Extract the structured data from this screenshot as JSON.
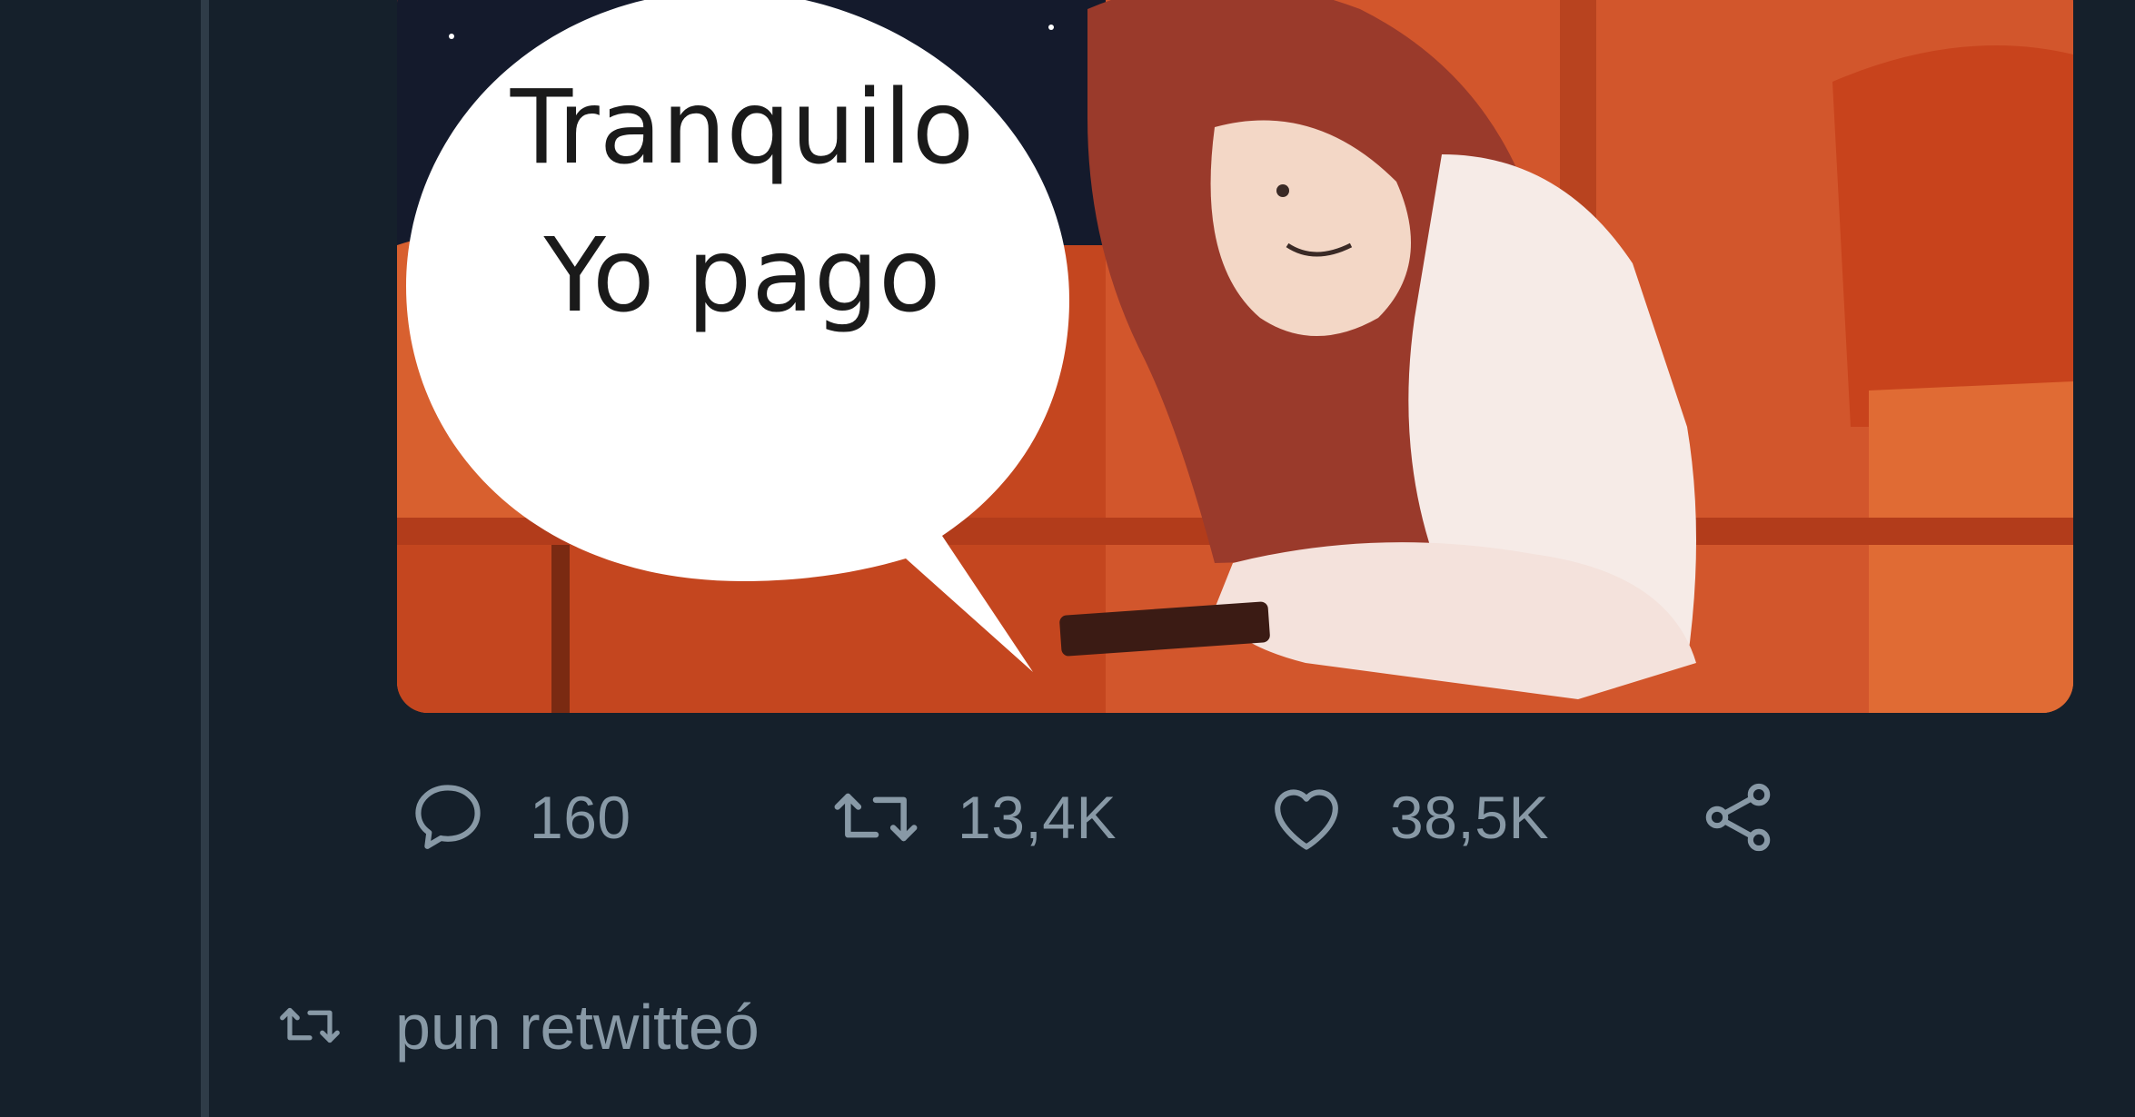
{
  "tweet": {
    "media": {
      "bubble_line1": "Tranquilo",
      "bubble_line2": "Yo pago"
    },
    "actions": {
      "reply_icon": "speech-bubble-icon",
      "reply_count": "160",
      "retweet_icon": "retweet-icon",
      "retweet_count": "13,4K",
      "like_icon": "heart-icon",
      "like_count": "38,5K",
      "share_icon": "share-icon"
    }
  },
  "next_item": {
    "context_icon": "retweet-icon",
    "context_label": "pun retwitteó"
  },
  "colors": {
    "background": "#15202b",
    "muted_text": "#8899a6",
    "thread_line": "#2f3c48"
  }
}
